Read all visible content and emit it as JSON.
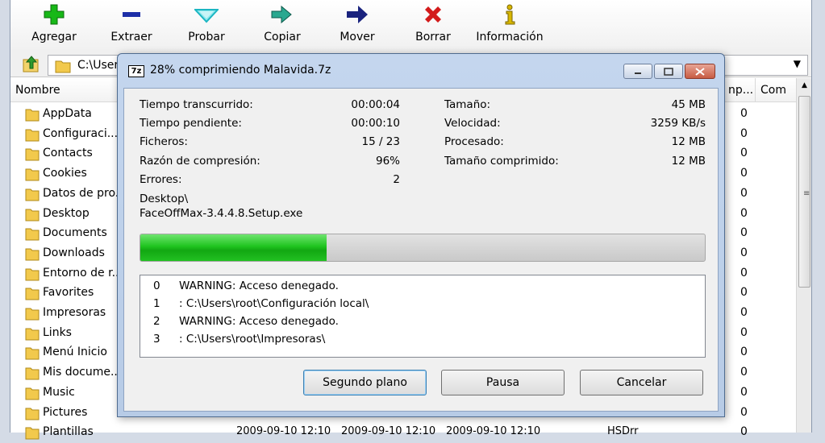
{
  "toolbar": {
    "buttons": [
      {
        "label": "Agregar",
        "icon": "plus-icon",
        "color": "#18b818"
      },
      {
        "label": "Extraer",
        "icon": "minus-icon",
        "color": "#1d2fa8"
      },
      {
        "label": "Probar",
        "icon": "check-chevron-icon",
        "color": "#1bb6c2"
      },
      {
        "label": "Copiar",
        "icon": "copy-arrow-icon",
        "color": "#1a8a7a"
      },
      {
        "label": "Mover",
        "icon": "arrow-right-icon",
        "color": "#1a237e"
      },
      {
        "label": "Borrar",
        "icon": "x-icon",
        "color": "#d31b1b"
      },
      {
        "label": "Información",
        "icon": "info-icon",
        "color": "#d8b700"
      }
    ]
  },
  "address": {
    "path": "C:\\User"
  },
  "filelist": {
    "columns": [
      "Nombre",
      "np...",
      "Com"
    ],
    "rows": [
      {
        "name": "AppData",
        "size": "0"
      },
      {
        "name": "Configuraci...",
        "size": "0"
      },
      {
        "name": "Contacts",
        "size": "0"
      },
      {
        "name": "Cookies",
        "size": "0"
      },
      {
        "name": "Datos de pro...",
        "size": "0"
      },
      {
        "name": "Desktop",
        "size": "0"
      },
      {
        "name": "Documents",
        "size": "0"
      },
      {
        "name": "Downloads",
        "size": "0"
      },
      {
        "name": "Entorno de r...",
        "size": "0"
      },
      {
        "name": "Favorites",
        "size": "0"
      },
      {
        "name": "Impresoras",
        "size": "0"
      },
      {
        "name": "Links",
        "size": "0"
      },
      {
        "name": "Menú Inicio",
        "size": "0"
      },
      {
        "name": "Mis docume...",
        "size": "0"
      },
      {
        "name": "Music",
        "size": "0"
      },
      {
        "name": "Pictures",
        "size": "0"
      },
      {
        "name": "Plantillas",
        "size": "0",
        "modified": "2009-09-10 12:10",
        "created": "2009-09-10 12:10",
        "accessed": "2009-09-10 12:10",
        "attr": "HSDrr"
      }
    ]
  },
  "dialog": {
    "title": "28% comprimiendo Malavida.7z",
    "logo": "7z",
    "stats_left": [
      {
        "label": "Tiempo transcurrido:",
        "value": "00:00:04"
      },
      {
        "label": "Tiempo pendiente:",
        "value": "00:00:10"
      },
      {
        "label": "Ficheros:",
        "value": "15 / 23"
      },
      {
        "label": "Razón de compresión:",
        "value": "96%"
      },
      {
        "label": "Errores:",
        "value": "2"
      }
    ],
    "stats_right": [
      {
        "label": "Tamaño:",
        "value": "45 MB"
      },
      {
        "label": "Velocidad:",
        "value": "3259 KB/s"
      },
      {
        "label": "Procesado:",
        "value": "12 MB"
      },
      {
        "label": "Tamaño comprimido:",
        "value": "12 MB"
      }
    ],
    "current_dir": "Desktop\\",
    "current_file": "FaceOffMax-3.4.4.8.Setup.exe",
    "progress_fraction": 0.33,
    "progress_color": "#1fc41f",
    "log": [
      {
        "n": "0",
        "text": "WARNING: Acceso denegado."
      },
      {
        "n": "1",
        "text": ": C:\\Users\\root\\Configuración local\\"
      },
      {
        "n": "2",
        "text": "WARNING: Acceso denegado."
      },
      {
        "n": "3",
        "text": ": C:\\Users\\root\\Impresoras\\"
      }
    ],
    "buttons": {
      "background": "Segundo plano",
      "pause": "Pausa",
      "cancel": "Cancelar"
    }
  }
}
